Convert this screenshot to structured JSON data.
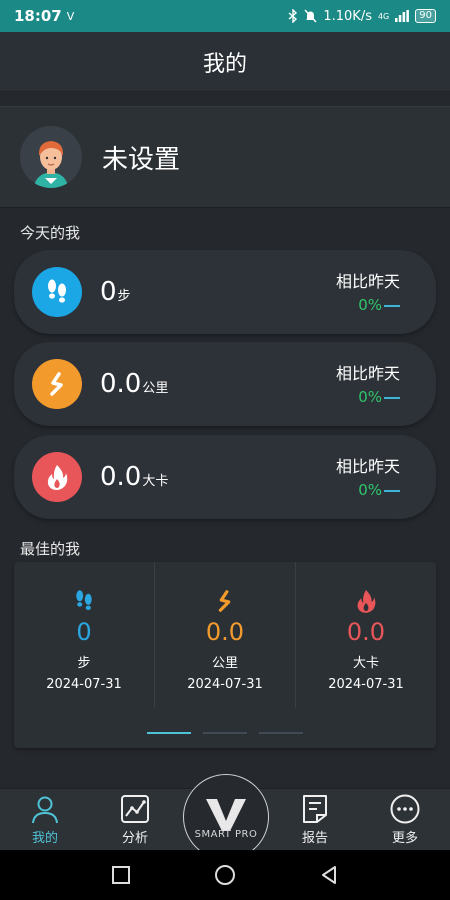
{
  "status_bar": {
    "time": "18:07",
    "indicator": "V",
    "network_speed": "1.10K/s",
    "signal": "4G",
    "battery": "90"
  },
  "header": {
    "title": "我的"
  },
  "profile": {
    "name": "未设置"
  },
  "today": {
    "label": "今天的我",
    "metrics": [
      {
        "value": "0",
        "unit": "步",
        "compare_label": "相比昨天",
        "change": "0%",
        "icon": "footsteps-icon",
        "color": "#1ba7e6"
      },
      {
        "value": "0.0",
        "unit": "公里",
        "compare_label": "相比昨天",
        "change": "0%",
        "icon": "distance-icon",
        "color": "#f39a2d"
      },
      {
        "value": "0.0",
        "unit": "大卡",
        "compare_label": "相比昨天",
        "change": "0%",
        "icon": "flame-icon",
        "color": "#e9565a"
      }
    ]
  },
  "best": {
    "label": "最佳的我",
    "items": [
      {
        "value": "0",
        "unit": "步",
        "date": "2024-07-31",
        "icon": "footsteps-icon",
        "color": "#2aa6e0"
      },
      {
        "value": "0.0",
        "unit": "公里",
        "date": "2024-07-31",
        "icon": "distance-icon",
        "color": "#f39a2d"
      },
      {
        "value": "0.0",
        "unit": "大卡",
        "date": "2024-07-31",
        "icon": "flame-icon",
        "color": "#e9565a"
      }
    ],
    "pager": {
      "pages": 3,
      "active": 1
    }
  },
  "bottom_nav": {
    "items": [
      {
        "label": "我的",
        "icon": "person-icon",
        "active": true
      },
      {
        "label": "分析",
        "icon": "chart-icon",
        "active": false
      },
      {
        "label": "报告",
        "icon": "report-icon",
        "active": false
      },
      {
        "label": "更多",
        "icon": "more-icon",
        "active": false
      }
    ],
    "center": {
      "brand": "SMART PRO",
      "icon": "logo-v-icon"
    }
  },
  "colors": {
    "accent": "#4fc3d6",
    "status_bar": "#1b8a86",
    "positive": "#2fc66b"
  }
}
